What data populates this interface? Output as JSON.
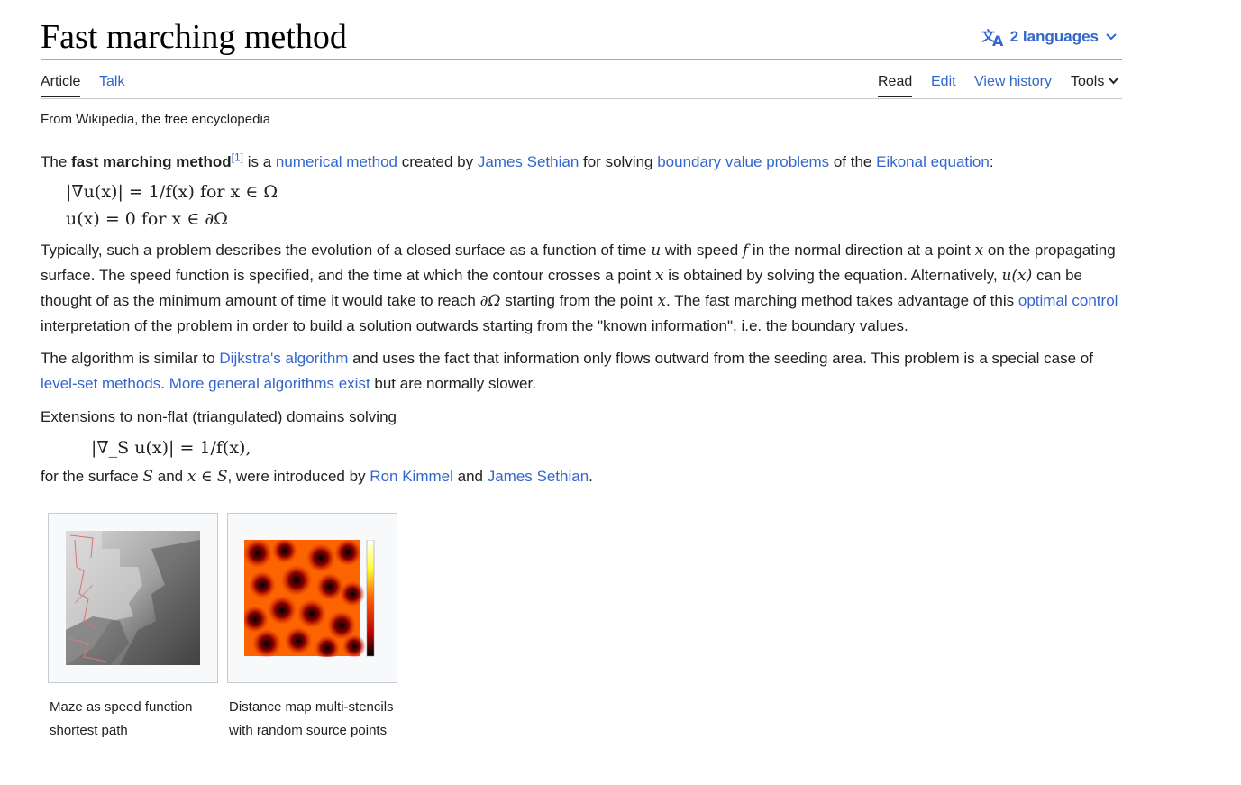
{
  "header": {
    "title": "Fast marching method",
    "languages_label": "2 languages"
  },
  "tabs": {
    "article": "Article",
    "talk": "Talk",
    "read": "Read",
    "edit": "Edit",
    "view_history": "View history",
    "tools": "Tools"
  },
  "tagline": "From Wikipedia, the free encyclopedia",
  "paragraph1": {
    "t1": "The ",
    "bold": "fast marching method",
    "ref": "[1]",
    "t2": " is a ",
    "link1": "numerical method",
    "t3": " created by ",
    "link2": "James Sethian",
    "t4": " for solving ",
    "link3": "boundary value problems",
    "t5": " of the ",
    "link4": "Eikonal equation",
    "t6": ":"
  },
  "equation1": {
    "line1": "|∇u(x)| = 1/f(x) for x ∈ Ω",
    "line2": "u(x) = 0 for x ∈ ∂Ω"
  },
  "paragraph2": {
    "t1": "Typically, such a problem describes the evolution of a closed surface as a function of time ",
    "m_u": "u",
    "t2": " with speed ",
    "m_f": "f",
    "t3": " in the normal direction at a point ",
    "m_x1": "x",
    "t4": " on the propagating surface. The speed function is specified, and the time at which the contour crosses a point ",
    "m_x2": "x",
    "t5": " is obtained by solving the equation. Alternatively, ",
    "m_ux": "u(x)",
    "t6": " can be thought of as the minimum amount of time it would take to reach ",
    "m_dO": "∂Ω",
    "t7": " starting from the point ",
    "m_x3": "x",
    "t8": ". The fast marching method takes advantage of this ",
    "link1": "optimal control",
    "t9": " interpretation of the problem in order to build a solution outwards starting from the \"known information\", i.e. the boundary values."
  },
  "paragraph3": {
    "t1": "The algorithm is similar to ",
    "link1": "Dijkstra's algorithm",
    "t2": " and uses the fact that information only flows outward from the seeding area. This problem is a special case of ",
    "link2": "level-set methods",
    "t3": ". ",
    "link3": "More general algorithms exist",
    "t4": " but are normally slower."
  },
  "paragraph4": "Extensions to non-flat (triangulated) domains solving",
  "equation2": "|∇_S u(x)| = 1/f(x),",
  "paragraph5": {
    "t1": "for the surface ",
    "m_S1": "S",
    "t2": " and ",
    "m_xS": "x ∈ S",
    "t3": ", were introduced by ",
    "link1": "Ron Kimmel",
    "t4": " and ",
    "link2": "James Sethian",
    "t5": "."
  },
  "gallery": [
    {
      "caption": "Maze as speed function shortest path",
      "icon": "maze-image"
    },
    {
      "caption": "Distance map multi-stencils with random source points",
      "icon": "distance-map-image"
    }
  ],
  "colors": {
    "link": "#3366cc",
    "text": "#202122",
    "border": "#a2a9b1"
  }
}
